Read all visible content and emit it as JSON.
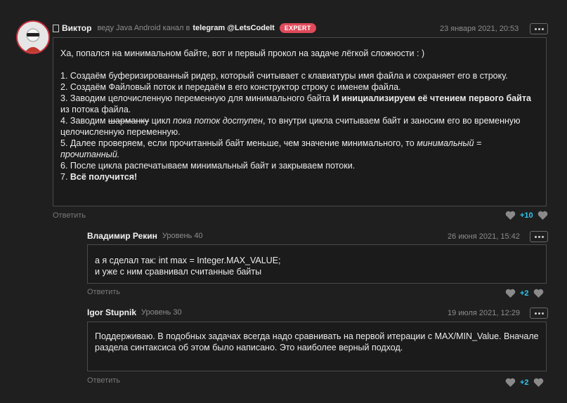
{
  "main_comment": {
    "author": "Виктор",
    "tagline": "веду Java Android канал в",
    "telegram_link": "telegram @LetsCodeIt",
    "badge": "EXPERT",
    "date": "23 января 2021, 20:53",
    "intro": "Ха, попался на минимальном байте, вот и первый прокол на задаче лёгкой сложности : )",
    "steps": {
      "s1": "1. Создаём буферизированный ридер, который считывает с клавиатуры имя файла и сохраняет его в строку.",
      "s2": "2. Создаём Файловый поток и передаём в его конструктор строку с именем файла.",
      "s3_a": "3. Заводим целочисленную переменную для минимального байта ",
      "s3_b": "И инициализируем  её чтением первого байта",
      "s3_c": " из потока файла.",
      "s4_a": "4. Заводим ",
      "s4_b": "шарманку",
      "s4_c": " цикл ",
      "s4_d": "пока поток доступен",
      "s4_e": ", то внутри цикла считываем байт и заносим его во временную целочисленную переменную.",
      "s5_a": "5. Далее проверяем, если прочитанный байт меньше, чем значение минимального, то ",
      "s5_b": "минимальный = прочитанный.",
      "s6": "6. После цикла распечатываем минимальный байт и закрываем потоки.",
      "s7_a": "7. ",
      "s7_b": "Всё получится!"
    },
    "reply_label": "Ответить",
    "score": "+10"
  },
  "replies": [
    {
      "author": "Владимир Рекин",
      "level": "Уровень 40",
      "date": "26 июня 2021, 15:42",
      "line1": "а я сделал так: int max = Integer.MAX_VALUE;",
      "line2": "и уже с ним сравнивал считанные байты",
      "reply_label": "Ответить",
      "score": "+2"
    },
    {
      "author": "Igor Stupnik",
      "level": "Уровень 30",
      "date": "19 июля 2021, 12:29",
      "text": "Поддерживаю. В подобных задачах всегда надо сравнивать на первой итерации с MAX/MIN_Value. Вначале раздела синтаксиса об этом было написано. Это наиболее верный подход.",
      "reply_label": "Ответить",
      "score": "+2"
    }
  ],
  "colors": {
    "accent": "#2ec8f0",
    "badge": "#e04a5a",
    "avatar_ring": "#c8323f"
  },
  "icons": {
    "like": "heart-icon",
    "more": "more-dots-icon",
    "channel": "document-icon"
  }
}
